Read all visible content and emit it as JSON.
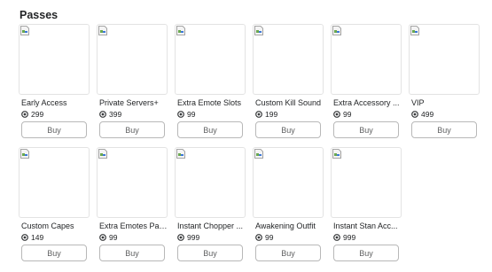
{
  "section": {
    "title": "Passes"
  },
  "passes": [
    {
      "name": "Early Access",
      "price": "299",
      "buy_label": "Buy"
    },
    {
      "name": "Private Servers+",
      "price": "399",
      "buy_label": "Buy"
    },
    {
      "name": "Extra Emote Slots",
      "price": "99",
      "buy_label": "Buy"
    },
    {
      "name": "Custom Kill Sound",
      "price": "199",
      "buy_label": "Buy"
    },
    {
      "name": "Extra Accessory ...",
      "price": "99",
      "buy_label": "Buy"
    },
    {
      "name": "VIP",
      "price": "499",
      "buy_label": "Buy"
    },
    {
      "name": "Custom Capes",
      "price": "149",
      "buy_label": "Buy"
    },
    {
      "name": "Extra Emotes Page",
      "price": "99",
      "buy_label": "Buy"
    },
    {
      "name": "Instant Chopper ...",
      "price": "999",
      "buy_label": "Buy"
    },
    {
      "name": "Awakening Outfit",
      "price": "99",
      "buy_label": "Buy"
    },
    {
      "name": "Instant Stan Acc...",
      "price": "999",
      "buy_label": "Buy"
    }
  ],
  "icons": {
    "thumbnail": "broken-image-icon",
    "currency": "robux-icon"
  },
  "colors": {
    "text": "#232527",
    "button_border": "#b8b8b8",
    "button_text": "#606162",
    "card_border": "#e3e3e3"
  }
}
